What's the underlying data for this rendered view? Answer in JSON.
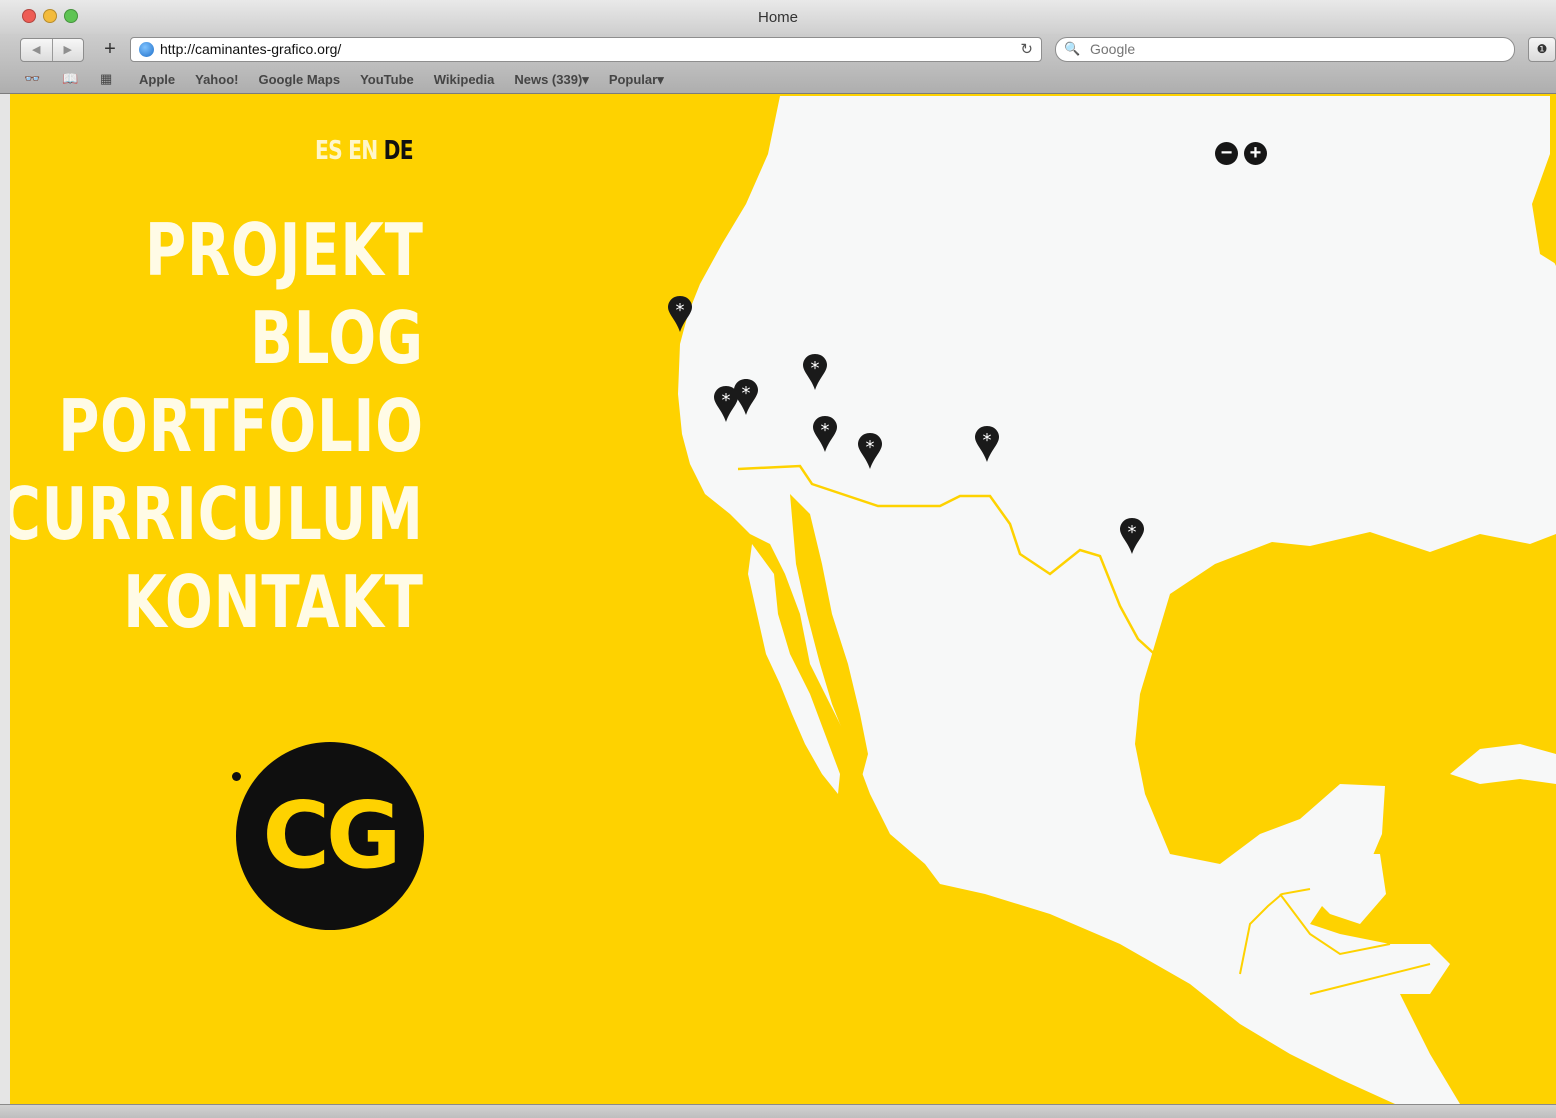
{
  "browser": {
    "window_title": "Home",
    "url": "http://caminantes-grafico.org/",
    "search_placeholder": "Google",
    "bookmarks": [
      "Apple",
      "Yahoo!",
      "Google Maps",
      "YouTube",
      "Wikipedia",
      "News (339)▾",
      "Popular▾"
    ]
  },
  "site": {
    "languages": {
      "es": "ES",
      "en": "EN",
      "de": "DE"
    },
    "menu": [
      "PROJEKT",
      "BLOG",
      "PORTFOLIO",
      "CURRICULUM",
      "KONTAKT"
    ],
    "logo": "CG",
    "zoom_out": "−",
    "zoom_in": "+",
    "pin_glyph": "*"
  },
  "colors": {
    "background": "#fed200",
    "land": "#f7f8f8",
    "border": "#fed200",
    "pin": "#1a1a1a"
  }
}
